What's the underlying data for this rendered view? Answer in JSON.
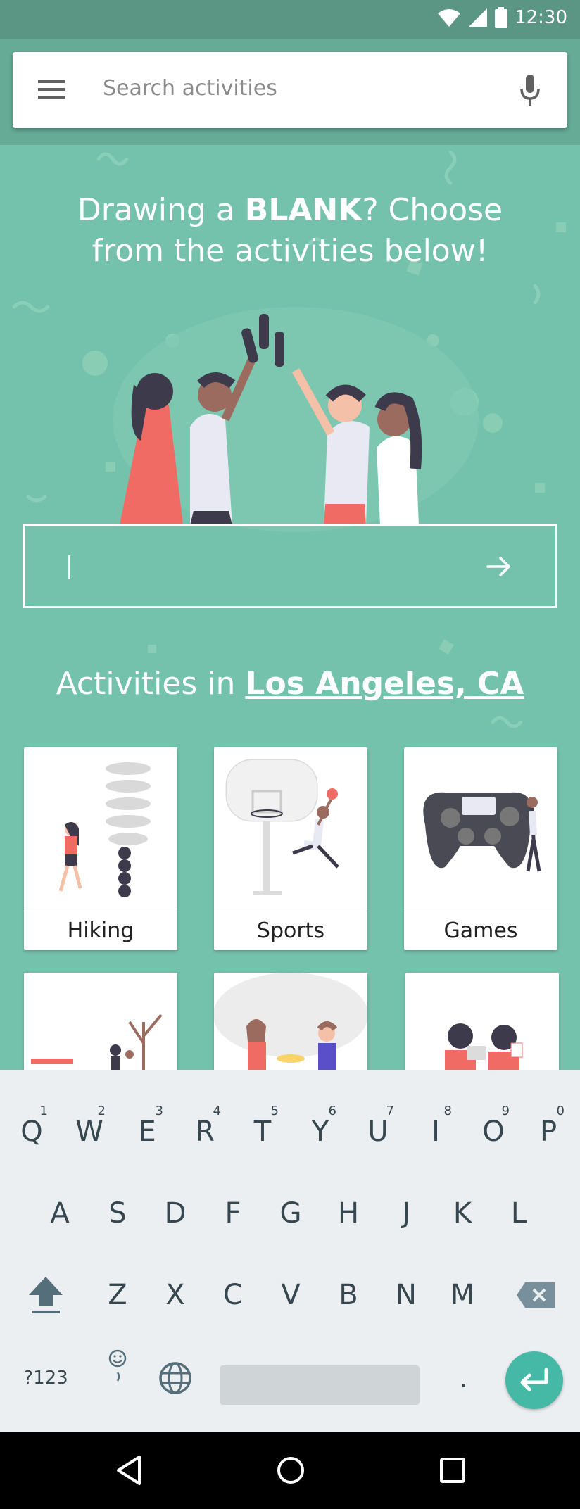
{
  "status_bar": {
    "time": "12:30",
    "icons": [
      "wifi-icon",
      "cell-signal-icon",
      "battery-icon"
    ]
  },
  "search": {
    "placeholder": "Search activities",
    "icons": [
      "menu-icon",
      "mic-icon"
    ]
  },
  "hero": {
    "headline_part1": "Drawing a ",
    "headline_bold": "BLANK",
    "headline_part2": "? Choose",
    "headline_line2": "from the activities below!",
    "input_value": ""
  },
  "location": {
    "prefix": "Activities in ",
    "city": "Los Angeles, CA"
  },
  "categories": [
    {
      "label": "Hiking"
    },
    {
      "label": "Sports"
    },
    {
      "label": "Games"
    },
    {
      "label": ""
    },
    {
      "label": ""
    },
    {
      "label": ""
    }
  ],
  "keyboard": {
    "row1": [
      {
        "key": "Q",
        "hint": "1"
      },
      {
        "key": "W",
        "hint": "2"
      },
      {
        "key": "E",
        "hint": "3"
      },
      {
        "key": "R",
        "hint": "4"
      },
      {
        "key": "T",
        "hint": "5"
      },
      {
        "key": "Y",
        "hint": "6"
      },
      {
        "key": "U",
        "hint": "7"
      },
      {
        "key": "I",
        "hint": "8"
      },
      {
        "key": "O",
        "hint": "9"
      },
      {
        "key": "P",
        "hint": "0"
      }
    ],
    "row2": [
      "A",
      "S",
      "D",
      "F",
      "G",
      "H",
      "J",
      "K",
      "L"
    ],
    "row3": [
      "Z",
      "X",
      "C",
      "V",
      "B",
      "N",
      "M"
    ],
    "symbols_label": "?123",
    "period_label": "."
  },
  "colors": {
    "background": "#74c2ab",
    "status_bar": "#5b9584",
    "accent": "#45b8a6",
    "coral": "#f06b63"
  }
}
